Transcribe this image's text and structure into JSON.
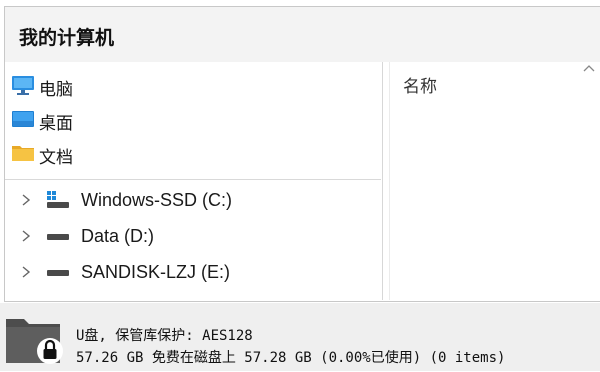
{
  "window": {
    "title": "我的计算机"
  },
  "nav": {
    "quick_access": [
      {
        "label": "电脑",
        "icon": "monitor-icon"
      },
      {
        "label": "桌面",
        "icon": "desktop-icon"
      },
      {
        "label": "文档",
        "icon": "folder-icon"
      }
    ],
    "drives": [
      {
        "label": "Windows-SSD (C:)",
        "icon": "windows-drive-icon"
      },
      {
        "label": "Data (D:)",
        "icon": "drive-icon"
      },
      {
        "label": "SANDISK-LZJ (E:)",
        "icon": "drive-icon"
      }
    ]
  },
  "details": {
    "column_name": "名称"
  },
  "status": {
    "line1": "U盘, 保管库保护: AES128",
    "line2": "57.26 GB 免费在磁盘上 57.28 GB (0.00%已使用) (0 items)",
    "icon": "locked-folder-icon"
  },
  "colors": {
    "status_bg": "#efefef",
    "titlebar_bg": "#f3f3f3",
    "folder_yellow": "#f6c343",
    "monitor_blue": "#2a8ee0"
  }
}
